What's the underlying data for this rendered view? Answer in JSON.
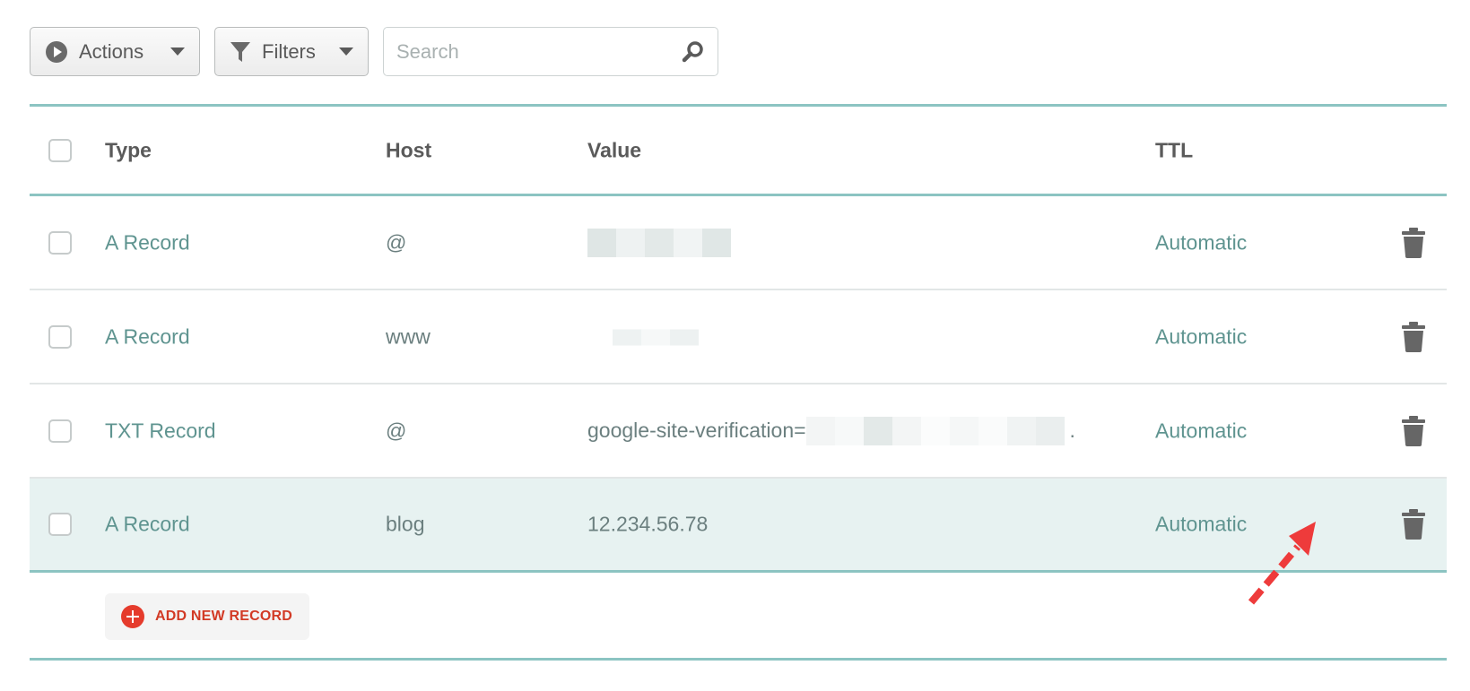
{
  "toolbar": {
    "actions_label": "Actions",
    "filters_label": "Filters",
    "search_placeholder": "Search"
  },
  "table": {
    "headers": {
      "type": "Type",
      "host": "Host",
      "value": "Value",
      "ttl": "TTL"
    },
    "rows": [
      {
        "type": "A Record",
        "host": "@",
        "value": "",
        "ttl": "Automatic"
      },
      {
        "type": "A Record",
        "host": "www",
        "value": "",
        "ttl": "Automatic"
      },
      {
        "type": "TXT Record",
        "host": "@",
        "value": "google-site-verification=",
        "value_suffix": ".",
        "ttl": "Automatic"
      },
      {
        "type": "A Record",
        "host": "blog",
        "value": "12.234.56.78",
        "ttl": "Automatic"
      }
    ]
  },
  "footer": {
    "add_label": "ADD NEW RECORD"
  },
  "colors": {
    "accent_border": "#8cc4c2",
    "link_text": "#5f9490",
    "selected_row_bg": "#e7f2f1",
    "add_button_red": "#e53b2c",
    "annotation_arrow": "#ee3b3b"
  },
  "icons": [
    "play-circle-icon",
    "caret-down-icon",
    "funnel-icon",
    "search-icon",
    "trash-icon",
    "plus-circle-icon",
    "annotation-arrow"
  ]
}
